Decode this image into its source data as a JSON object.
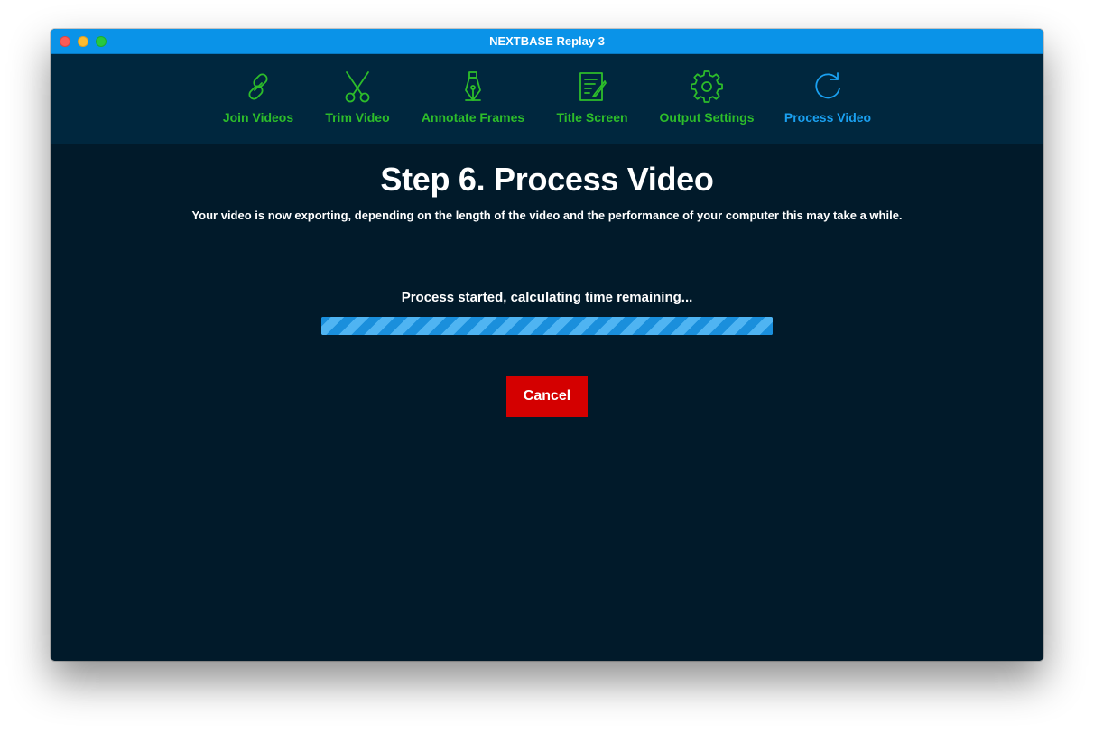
{
  "window": {
    "title": "NEXTBASE Replay 3"
  },
  "colors": {
    "titlebar": "#0a93e8",
    "nav_background": "#00273e",
    "content_background": "#011a2a",
    "nav_inactive": "#2dbd2a",
    "nav_active": "#1aa0f0",
    "progress": "#1a8fdc",
    "cancel_button": "#d40000"
  },
  "nav": {
    "items": [
      {
        "label": "Join Videos",
        "icon": "link-icon",
        "active": false
      },
      {
        "label": "Trim Video",
        "icon": "scissors-icon",
        "active": false
      },
      {
        "label": "Annotate Frames",
        "icon": "pen-nib-icon",
        "active": false
      },
      {
        "label": "Title Screen",
        "icon": "edit-document-icon",
        "active": false
      },
      {
        "label": "Output Settings",
        "icon": "gear-icon",
        "active": false
      },
      {
        "label": "Process Video",
        "icon": "refresh-icon",
        "active": true
      }
    ]
  },
  "main": {
    "step_title": "Step 6. Process Video",
    "description": "Your video is now exporting, depending on the length of the video and the performance of your computer this may take a while.",
    "status": "Process started, calculating time remaining...",
    "progress_state": "indeterminate",
    "cancel_label": "Cancel"
  }
}
